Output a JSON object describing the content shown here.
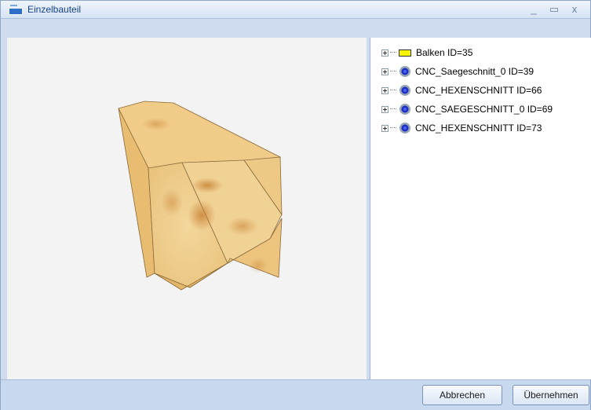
{
  "window": {
    "title": "Einzelbauteil",
    "minimize_glyph": "_",
    "maximize_glyph": "▭",
    "close_glyph": "x"
  },
  "tree": {
    "items": [
      {
        "label": "Balken ID=35",
        "icon": "beam-icon"
      },
      {
        "label": "CNC_Saegeschnitt_0 ID=39",
        "icon": "gear-icon"
      },
      {
        "label": "CNC_HEXENSCHNITT ID=66",
        "icon": "gear-icon"
      },
      {
        "label": "CNC_SAEGESCHNITT_0 ID=69",
        "icon": "gear-icon"
      },
      {
        "label": "CNC_HEXENSCHNITT ID=73",
        "icon": "gear-icon"
      }
    ]
  },
  "buttons": {
    "cancel": "Abbrechen",
    "apply": "Übernehmen"
  },
  "colors": {
    "accent": "#15428b",
    "beam": "#f6f600",
    "gear": "#1a2fbf",
    "wood": "#f0cf8e"
  }
}
